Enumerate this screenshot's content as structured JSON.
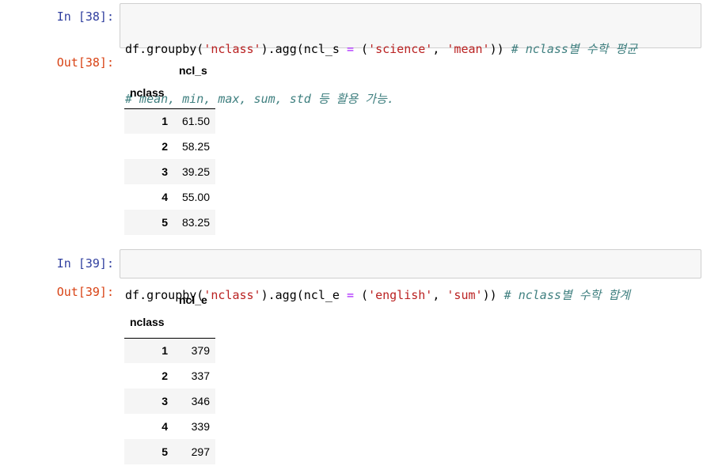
{
  "cells": [
    {
      "in_prompt": "In [38]:",
      "out_prompt": "Out[38]:",
      "code": {
        "line1_var": "df",
        "line1_a": ".groupby(",
        "line1_s1": "'nclass'",
        "line1_b": ").agg(ncl_s ",
        "line1_eq": "=",
        "line1_c": " (",
        "line1_s2": "'science'",
        "line1_d": ", ",
        "line1_s3": "'mean'",
        "line1_e": ")) ",
        "line1_comment": "# nclass별 수학 평균",
        "line2_comment": "# mean, min, max, sum, std 등 활용 가능."
      },
      "table": {
        "column": "ncl_s",
        "index_name": "nclass",
        "rows": [
          {
            "idx": "1",
            "val": "61.50"
          },
          {
            "idx": "2",
            "val": "58.25"
          },
          {
            "idx": "3",
            "val": "39.25"
          },
          {
            "idx": "4",
            "val": "55.00"
          },
          {
            "idx": "5",
            "val": "83.25"
          }
        ]
      }
    },
    {
      "in_prompt": "In [39]:",
      "out_prompt": "Out[39]:",
      "code": {
        "line1_var": "df",
        "line1_a": ".groupby(",
        "line1_s1": "'nclass'",
        "line1_b": ").agg(ncl_e ",
        "line1_eq": "=",
        "line1_c": " (",
        "line1_s2": "'english'",
        "line1_d": ", ",
        "line1_s3": "'sum'",
        "line1_e": ")) ",
        "line1_comment": "# nclass별 수학 합계"
      },
      "table": {
        "column": "ncl_e",
        "index_name": "nclass",
        "rows": [
          {
            "idx": "1",
            "val": "379"
          },
          {
            "idx": "2",
            "val": "337"
          },
          {
            "idx": "3",
            "val": "346"
          },
          {
            "idx": "4",
            "val": "339"
          },
          {
            "idx": "5",
            "val": "297"
          }
        ]
      }
    }
  ]
}
